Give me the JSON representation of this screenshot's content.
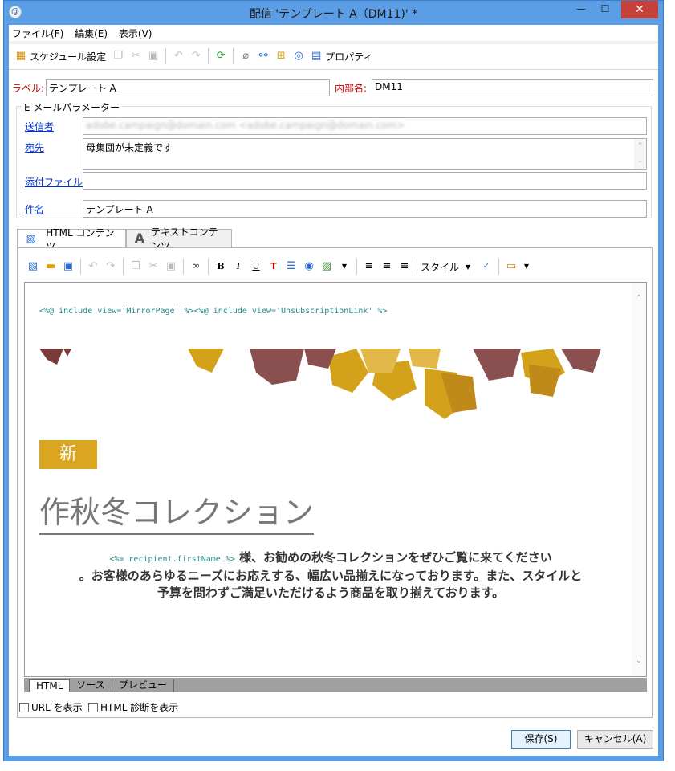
{
  "window": {
    "title": "配信 'テンプレート A（DM11)' *",
    "min_glyph": "—",
    "max_glyph": "☐",
    "close_glyph": "✕",
    "app_glyph": "@"
  },
  "menu": [
    "ファイル(F)",
    "編集(E)",
    "表示(V)"
  ],
  "toolbar": {
    "schedule_label": "スケジュール設定",
    "properties_label": "プロパティ"
  },
  "form": {
    "label_caption": "ラベル:",
    "label_value": "テンプレート A",
    "internal_caption": "内部名:",
    "internal_value": "DM11",
    "group_title": "E メールパラメーター",
    "sender_caption": "送信者",
    "sender_value": "adobe.campaign@domain.com <adobe.campaign@domain.com>",
    "to_caption": "宛先",
    "to_value": "母集団が未定義です",
    "attach_caption": "添付ファイル",
    "attach_value": "",
    "subject_caption": "件名",
    "subject_value": "テンプレート A"
  },
  "tabs": [
    "HTML コンテンツ",
    "テキストコンテンツ"
  ],
  "editor_toolbar": {
    "style_label": "スタイル"
  },
  "content": {
    "include_code": "<%@ include view='MirrorPage' %><%@ include view='UnsubscriptionLink' %>",
    "badge": "新",
    "headline": "作秋冬コレクション",
    "recipient_code": "<%= recipient.firstName %>",
    "body_line1": " 様、お勧めの秋冬コレクションをぜひご覧に来てください",
    "body_line2": "。お客様のあらゆるニーズにお応えする、幅広い品揃えになっております。また、スタイルと",
    "body_line3": "予算を問わずご満足いただけるよう商品を取り揃えております。"
  },
  "bottom_tabs": [
    "HTML",
    "ソース",
    "プレビュー"
  ],
  "options": {
    "show_url": "URL を表示",
    "show_html_diag": "HTML 診断を表示"
  },
  "buttons": {
    "save": "保存(S)",
    "cancel": "キャンセル(A)"
  }
}
